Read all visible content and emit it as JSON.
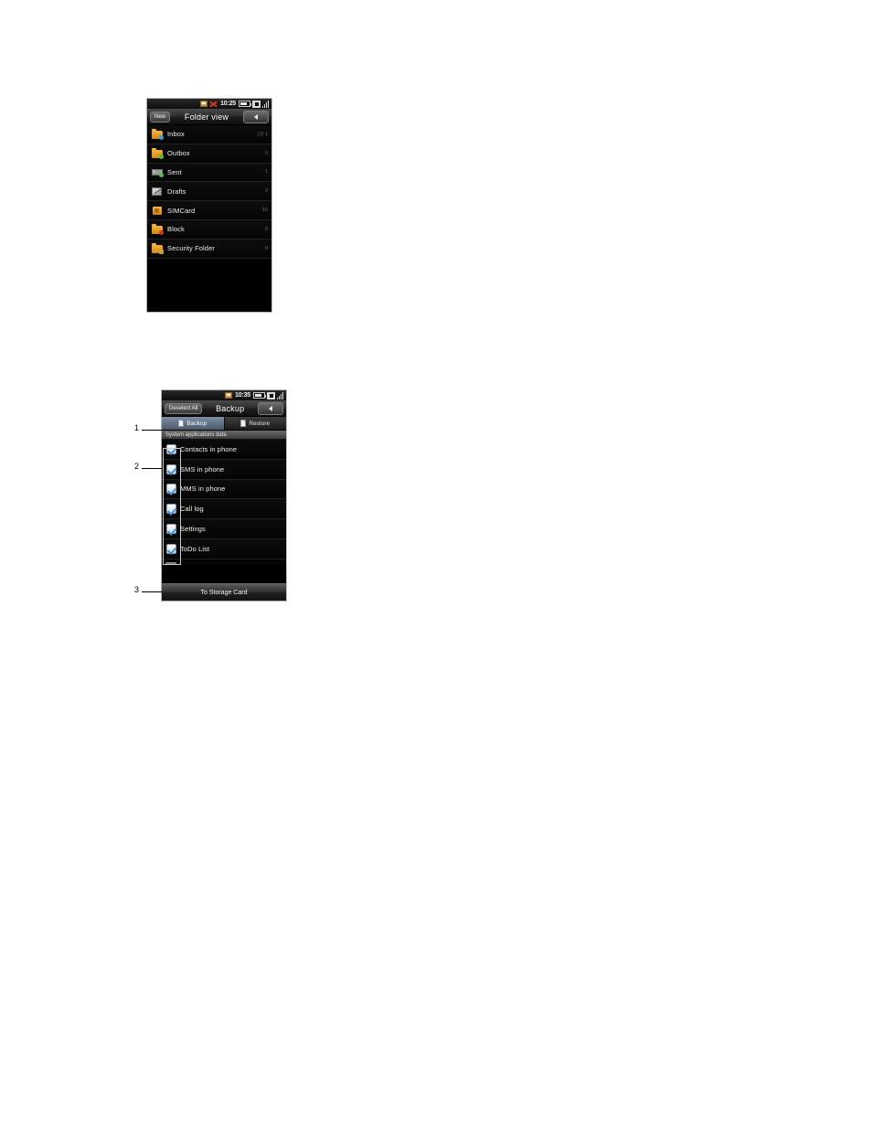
{
  "page": {
    "background": "#ffffff",
    "accent_blue": "#3e8fd4",
    "folder_orange": "#f2b43c",
    "tab_active_bg": "#5a6b80"
  },
  "screen_one": {
    "name": "messaging-folder-view",
    "status_bar": {
      "icons": [
        "sd-card-icon",
        "mute-icon"
      ],
      "time": "10:25",
      "battery": "battery-icon",
      "indicator": "square-indicator-icon",
      "signal": "signal-bars-icon"
    },
    "title_bar": {
      "new_label": "New",
      "title": "Folder view",
      "back_icon": "back-arrow-icon"
    },
    "folders": [
      {
        "label": "Inbox",
        "count": "(1) 1",
        "icon": "folder-inbox-icon",
        "badge": "blue"
      },
      {
        "label": "Outbox",
        "count": "0",
        "icon": "folder-outbox-icon",
        "badge": "green"
      },
      {
        "label": "Sent",
        "count": "1",
        "icon": "envelope-sent-icon",
        "badge": "green"
      },
      {
        "label": "Drafts",
        "count": "2",
        "icon": "pencil-draft-icon",
        "badge": "none"
      },
      {
        "label": "SIMCard",
        "count": "15",
        "icon": "sim-card-icon",
        "badge": "none"
      },
      {
        "label": "Block",
        "count": "0",
        "icon": "folder-block-icon",
        "badge": "red"
      },
      {
        "label": "Security Folder",
        "count": "0",
        "icon": "folder-security-icon",
        "badge": "lock"
      }
    ]
  },
  "screen_two": {
    "name": "backup-screen",
    "status_bar": {
      "icons": [
        "sd-card-icon"
      ],
      "time": "10:35",
      "battery": "battery-icon",
      "indicator": "square-indicator-icon",
      "signal": "signal-bars-icon"
    },
    "title_bar": {
      "deselect_label": "Deselect All",
      "title": "Backup",
      "back_icon": "back-arrow-icon"
    },
    "tabs": [
      {
        "label": "Backup",
        "active": true,
        "icon": "document-icon"
      },
      {
        "label": "Restore",
        "active": false,
        "icon": "document-icon"
      }
    ],
    "section_header": "System applications data",
    "items": [
      {
        "label": "Contacts in phone",
        "checked": true
      },
      {
        "label": "SMS in phone",
        "checked": true
      },
      {
        "label": "MMS in phone",
        "checked": true
      },
      {
        "label": "Call log",
        "checked": true
      },
      {
        "label": "Settings",
        "checked": true
      },
      {
        "label": "ToDo List",
        "checked": true
      }
    ],
    "bottom_button": "To Storage Card"
  },
  "callouts": [
    {
      "number": "1",
      "target": "tabs-row"
    },
    {
      "number": "2",
      "target": "checkbox-column"
    },
    {
      "number": "3",
      "target": "bottom-button"
    }
  ]
}
